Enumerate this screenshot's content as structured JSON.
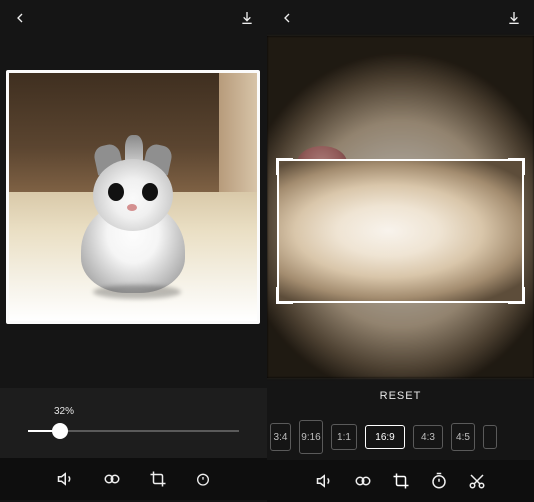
{
  "left": {
    "progress": {
      "label": "32%",
      "value": 32
    },
    "tools": [
      "volume-icon",
      "link-icon",
      "crop-icon",
      "timer-icon-partial"
    ]
  },
  "right": {
    "reset_label": "RESET",
    "ratios": [
      {
        "id": "3:4",
        "label": "3:4",
        "selected": false,
        "cls": "r-34"
      },
      {
        "id": "9:16",
        "label": "9:16",
        "selected": false,
        "cls": "r-916"
      },
      {
        "id": "1:1",
        "label": "1:1",
        "selected": false,
        "cls": "r-11"
      },
      {
        "id": "16:9",
        "label": "16:9",
        "selected": true,
        "cls": "r-169"
      },
      {
        "id": "4:3",
        "label": "4:3",
        "selected": false,
        "cls": "r-43"
      },
      {
        "id": "4:5",
        "label": "4:5",
        "selected": false,
        "cls": "r-45"
      }
    ],
    "tools": [
      "volume-icon",
      "link-icon",
      "crop-icon",
      "timer-icon",
      "cut-icon"
    ]
  }
}
